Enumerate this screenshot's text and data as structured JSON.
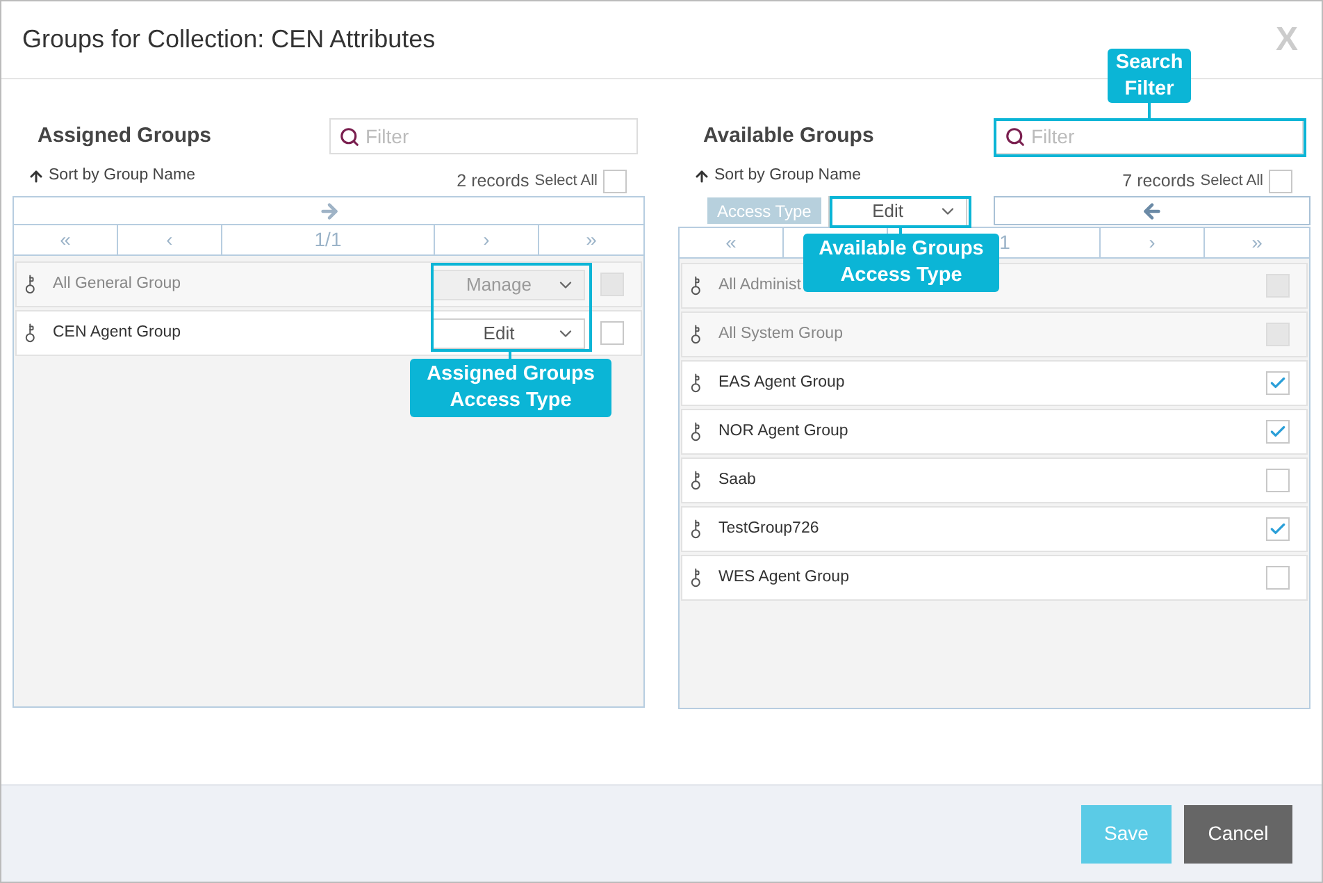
{
  "dialog": {
    "title": "Groups for Collection: CEN Attributes",
    "close": "X"
  },
  "assigned": {
    "heading": "Assigned Groups",
    "filter_placeholder": "Filter",
    "sort_label": "Sort by Group Name",
    "records": "2 records",
    "select_all_label": "Select All",
    "select_all_checked": false,
    "pager": {
      "first": "«",
      "prev": "‹",
      "page": "1/1",
      "next": "›",
      "last": "»"
    },
    "rows": [
      {
        "name": "All General Group",
        "access": "Manage",
        "disabled": true,
        "checked": false
      },
      {
        "name": "CEN Agent Group",
        "access": "Edit",
        "disabled": false,
        "checked": false
      }
    ]
  },
  "available": {
    "heading": "Available Groups",
    "filter_placeholder": "Filter",
    "sort_label": "Sort by Group Name",
    "records": "7 records",
    "select_all_label": "Select All",
    "select_all_checked": false,
    "access_type_label": "Access Type",
    "access_type_value": "Edit",
    "pager": {
      "first": "«",
      "page": "1",
      "next": "›",
      "last": "»"
    },
    "rows": [
      {
        "name": "All Administ",
        "disabled": true,
        "checked": false
      },
      {
        "name": "All System Group",
        "disabled": true,
        "checked": false
      },
      {
        "name": "EAS Agent Group",
        "disabled": false,
        "checked": true
      },
      {
        "name": "NOR Agent Group",
        "disabled": false,
        "checked": true
      },
      {
        "name": "Saab",
        "disabled": false,
        "checked": false
      },
      {
        "name": "TestGroup726",
        "disabled": false,
        "checked": true
      },
      {
        "name": "WES Agent Group",
        "disabled": false,
        "checked": false
      }
    ]
  },
  "callouts": [
    {
      "text": "Search\nFilter"
    },
    {
      "text": "Available Groups\nAccess Type"
    },
    {
      "text": "Assigned Groups\nAccess Type"
    }
  ],
  "buttons": [
    {
      "label": "Save",
      "kind": "primary"
    },
    {
      "label": "Cancel",
      "kind": "secondary"
    }
  ]
}
